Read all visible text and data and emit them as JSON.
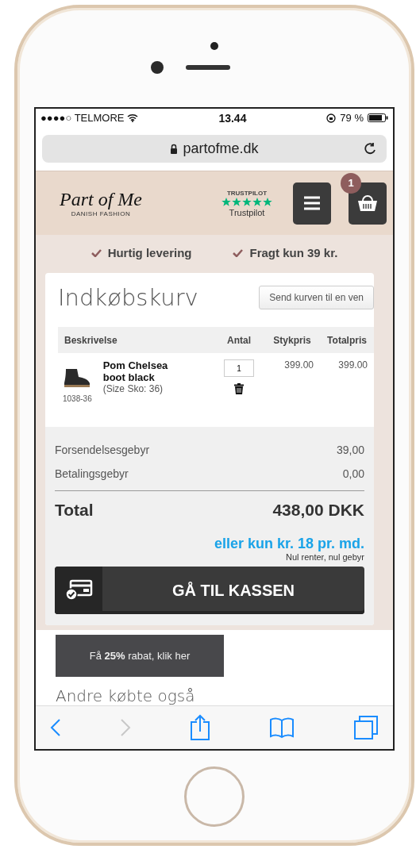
{
  "status_bar": {
    "carrier": "●●●●○ TELMORE",
    "time": "13.44",
    "battery": "79 %"
  },
  "address_bar": {
    "url": "partofme.dk"
  },
  "header": {
    "logo": "Part of Me",
    "logo_tagline": "DANISH FASHION",
    "trustpilot_brand": "TRUSTPILOT",
    "trustpilot_label": "Trustpilot",
    "stars": 5,
    "cart_count": "1"
  },
  "usps": [
    "Hurtig levering",
    "Fragt kun 39 kr."
  ],
  "cart": {
    "title": "Indkøbskurv",
    "share_button": "Send kurven til en ven",
    "columns": [
      "Beskrivelse",
      "Antal",
      "Stykpris",
      "Totalpris"
    ],
    "items": [
      {
        "name": "Pom Chelsea boot black",
        "variant": "(Size Sko: 36)",
        "sku": "1038-36",
        "quantity": "1",
        "unit_price": "399.00",
        "total_price": "399.00"
      }
    ],
    "fees": [
      {
        "label": "Forsendelsesgebyr",
        "value": "39,00"
      },
      {
        "label": "Betalingsgebyr",
        "value": "0,00"
      }
    ],
    "total_label": "Total",
    "total_value": "438,00 DKK",
    "installment": "eller kun kr. 18 pr. md.",
    "installment_note": "Nul renter, nul gebyr",
    "checkout_button": "GÅ TIL KASSEN"
  },
  "discount_banner": "Få **25%** rabat, klik her",
  "section_heading": "Andre købte også",
  "toolbar": [
    {
      "kind": "back",
      "disabled": false
    },
    {
      "kind": "forward",
      "disabled": true
    },
    {
      "kind": "share",
      "disabled": false
    },
    {
      "kind": "bookmarks",
      "disabled": false
    },
    {
      "kind": "tabs",
      "disabled": false
    }
  ]
}
